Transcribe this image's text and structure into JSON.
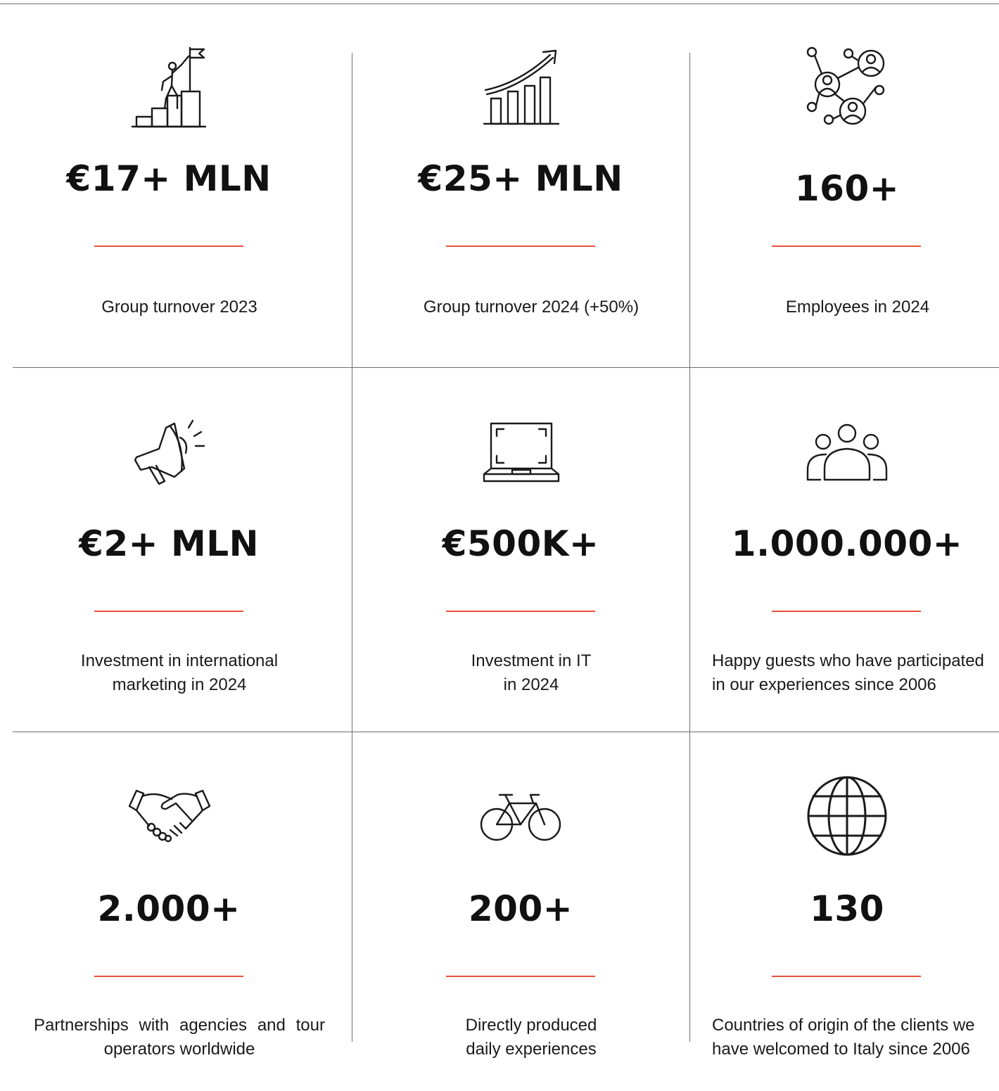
{
  "colors": {
    "accent": "#e8533a",
    "divider": "#6f6f6f",
    "text": "#1a1a1a",
    "value": "#111111"
  },
  "stats": [
    {
      "icon": "climber-flag-icon",
      "value": "€17+ MLN",
      "caption": "Group turnover 2023"
    },
    {
      "icon": "growth-chart-icon",
      "value": "€25+ MLN",
      "caption": "Group turnover 2024 (+50%)"
    },
    {
      "icon": "network-people-icon",
      "value": "160+",
      "caption": "Employees in 2024"
    },
    {
      "icon": "megaphone-icon",
      "value": "€2+ MLN",
      "caption": "Investment in international\nmarketing in 2024"
    },
    {
      "icon": "laptop-icon",
      "value": "€500K+",
      "caption": "Investment in IT\nin 2024"
    },
    {
      "icon": "group-people-icon",
      "value": "1.000.000+",
      "caption": "Happy guests who have participated\nin our experiences since 2006"
    },
    {
      "icon": "handshake-icon",
      "value": "2.000+",
      "caption": "Partnerships with agencies and tour operators worldwide"
    },
    {
      "icon": "bicycle-icon",
      "value": "200+",
      "caption": "Directly produced\ndaily experiences"
    },
    {
      "icon": "globe-icon",
      "value": "130",
      "caption": "Countries of origin of the clients we\nhave welcomed to Italy since 2006"
    }
  ]
}
